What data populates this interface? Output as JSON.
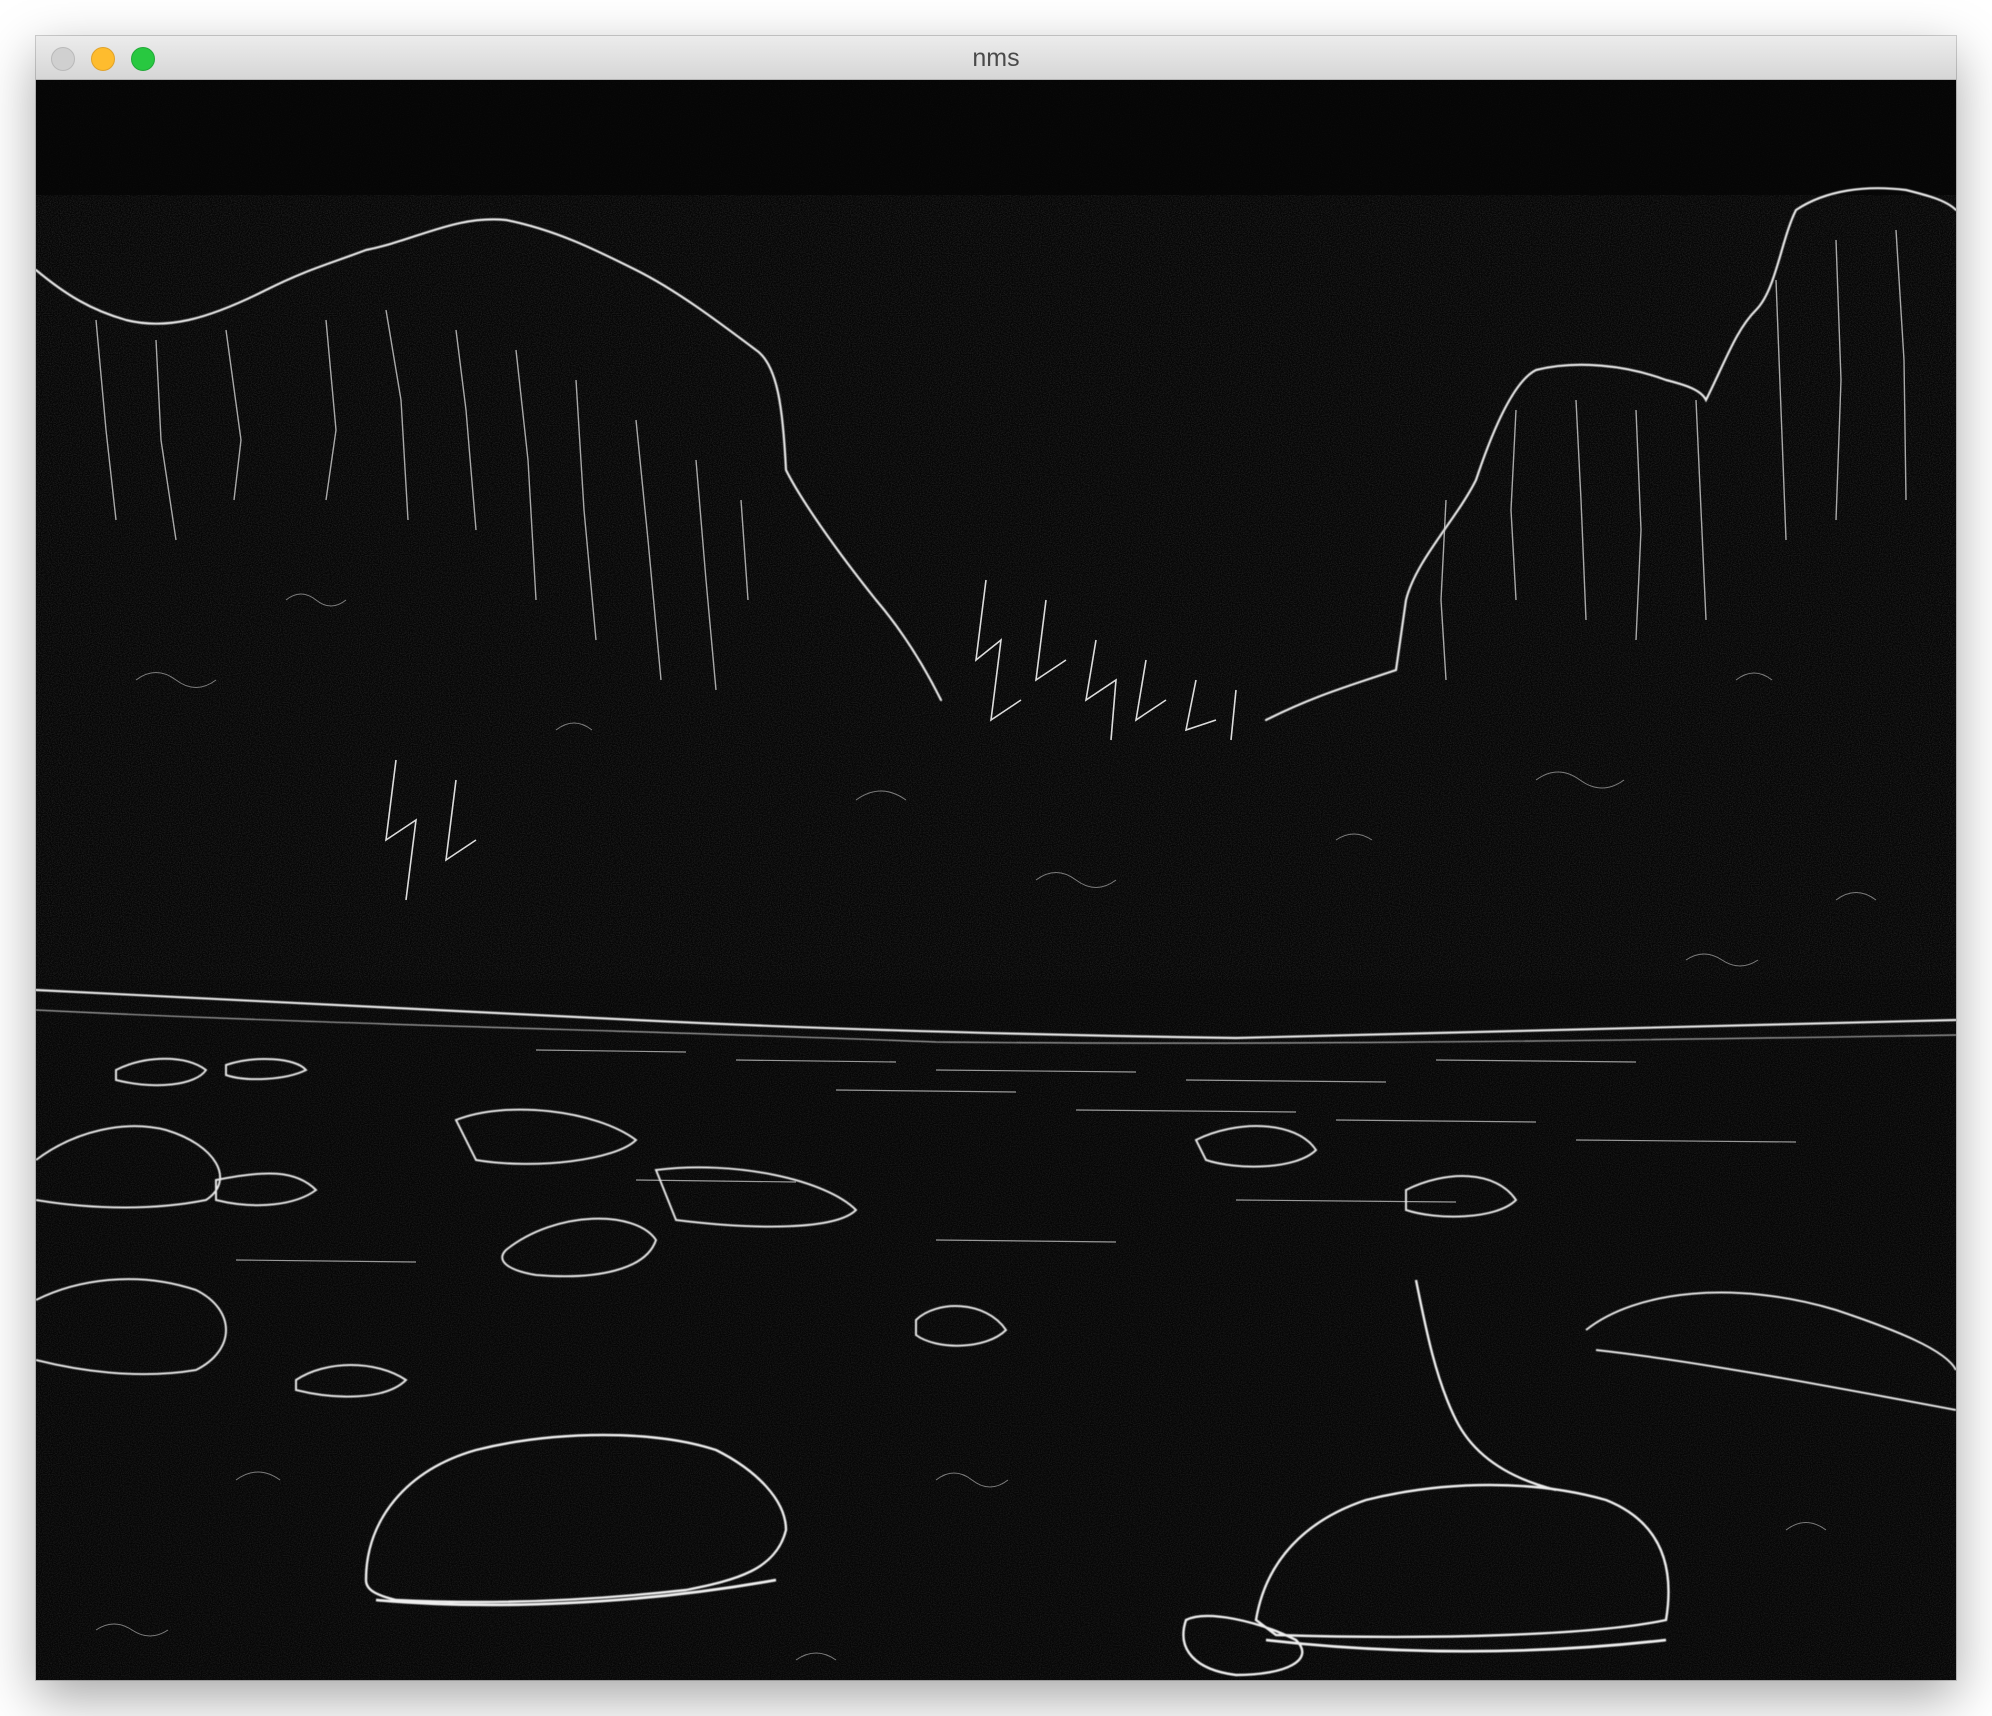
{
  "window": {
    "title": "nms"
  },
  "controls": {
    "close_icon": "close-icon",
    "minimize_icon": "minimize-icon",
    "zoom_icon": "zoom-icon",
    "colors": {
      "close": "#d0d0d0",
      "minimize": "#febc2e",
      "zoom": "#28c840"
    }
  },
  "image_view": {
    "content": "edge-map",
    "background_color": "#050505",
    "edge_color": "#e8e8e8"
  }
}
